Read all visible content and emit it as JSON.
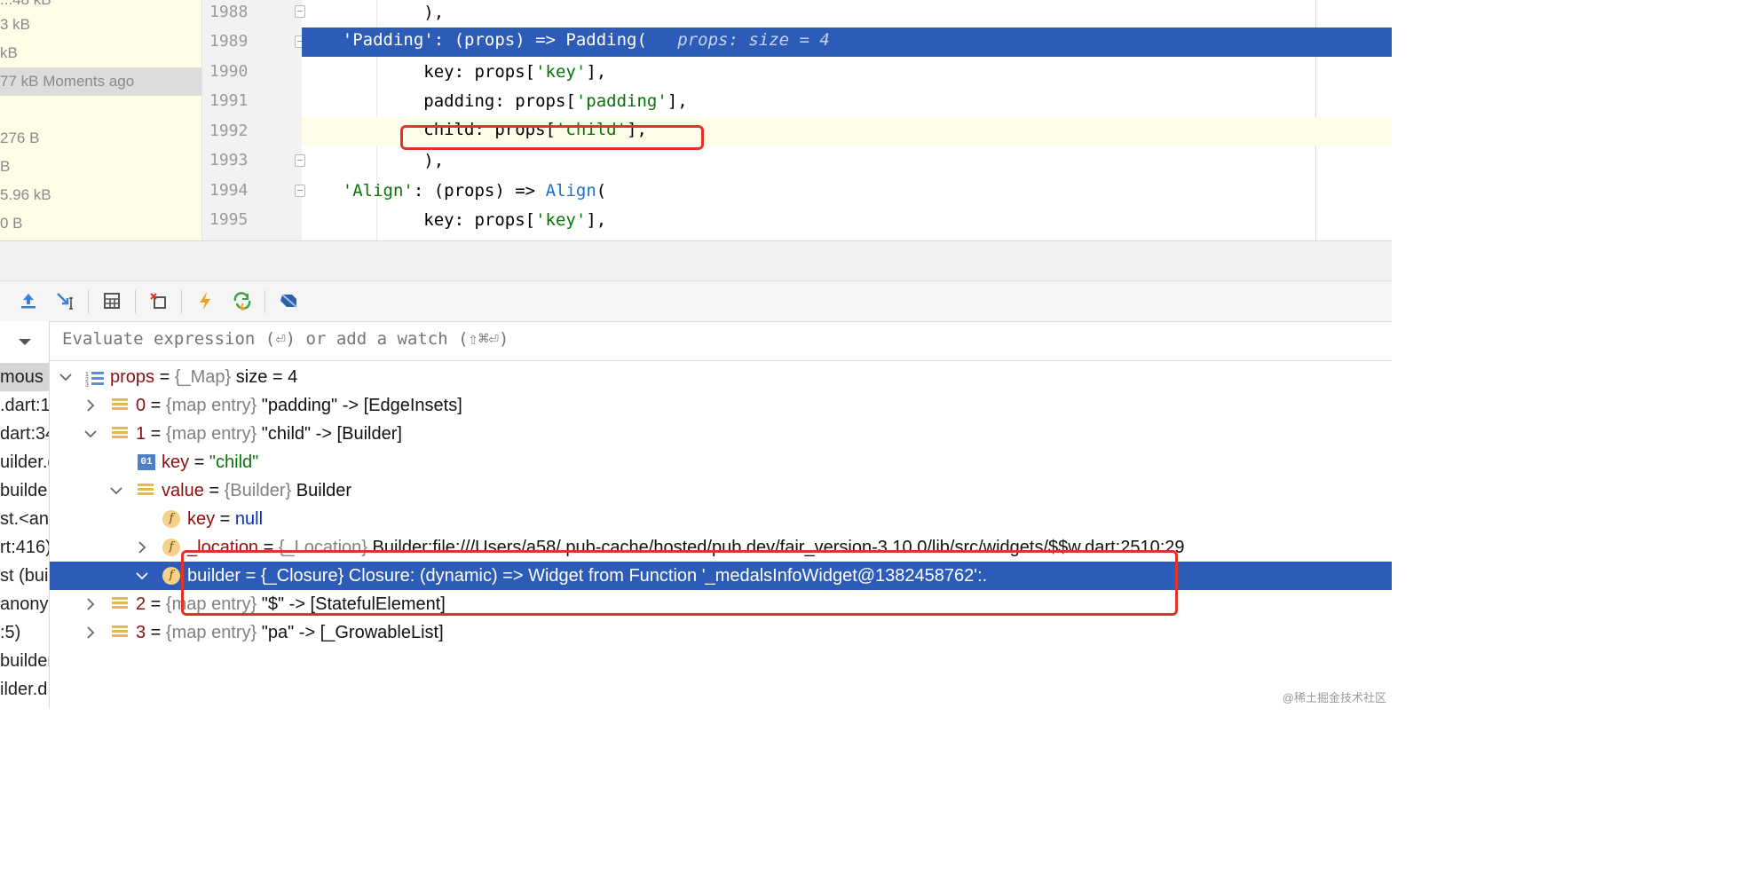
{
  "file_list": {
    "rows": [
      {
        "text": "...48 kB"
      },
      {
        "text": "3 kB"
      },
      {
        "text": "kB"
      },
      {
        "text": "77 kB Moments ago"
      },
      {
        "text": ""
      },
      {
        "text": "276 B"
      },
      {
        "text": "B"
      },
      {
        "text": "5.96 kB"
      },
      {
        "text": "0 B"
      }
    ]
  },
  "editor": {
    "lines": [
      {
        "num": "1988",
        "code": "            ),"
      },
      {
        "num": "1989",
        "code_a": "'Padding'",
        "code_b": ": (props) => Padding(",
        "hint": "props: size = 4"
      },
      {
        "num": "1990",
        "pre": "    key: props[",
        "str": "'key'",
        "post": "],"
      },
      {
        "num": "1991",
        "pre": "    padding: props[",
        "str": "'padding'",
        "post": "],"
      },
      {
        "num": "1992",
        "pre": "    child: props[",
        "str": "'child'",
        "post": "],"
      },
      {
        "num": "1993",
        "code": "            ),"
      },
      {
        "num": "1994",
        "str": "'Align'",
        "mid": ": (props) => ",
        "fn": "Align",
        "post": "("
      },
      {
        "num": "1995",
        "pre": "    key: props[",
        "str": "'key'",
        "post": "],"
      }
    ]
  },
  "toolbar": {
    "buttons": [
      {
        "name": "step-out-icon"
      },
      {
        "name": "run-to-cursor-icon"
      },
      {
        "name": "evaluate-icon"
      },
      {
        "name": "drop-frame-icon"
      },
      {
        "name": "hot-reload-icon"
      },
      {
        "name": "hot-restart-icon"
      },
      {
        "name": "dart-devtools-icon"
      }
    ]
  },
  "evaluate": {
    "placeholder": "Evaluate expression (⏎) or add a watch (⇧⌘⏎)"
  },
  "frames": [
    {
      "text": "mous"
    },
    {
      "text": ".dart:1"
    },
    {
      "text": "dart:34"
    },
    {
      "text": "uilder.d"
    },
    {
      "text": "builde"
    },
    {
      "text": "st.<an"
    },
    {
      "text": "rt:416)"
    },
    {
      "text": "st (bui"
    },
    {
      "text": "anony"
    },
    {
      "text": ":5)"
    },
    {
      "text": "builder"
    },
    {
      "text": "ilder.d"
    }
  ],
  "variables": {
    "props": {
      "name": "props",
      "eq": " = ",
      "type": "{_Map}",
      "val": " size = 4"
    },
    "entry0": {
      "name": "0",
      "eq": " = ",
      "type": "{map entry}",
      "val": " \"padding\" -> [EdgeInsets]"
    },
    "entry1": {
      "name": "1",
      "eq": " = ",
      "type": "{map entry}",
      "val": " \"child\" -> [Builder]"
    },
    "key": {
      "name": "key",
      "eq": " = ",
      "val": "\"child\""
    },
    "value": {
      "name": "value",
      "eq": " = ",
      "type": "{Builder}",
      "val": " Builder"
    },
    "value_key": {
      "name": "key",
      "eq": " = ",
      "val": "null"
    },
    "location": {
      "name": "_location",
      "eq": " = ",
      "type": "{_Location}",
      "val": " Builder:file:///Users/a58/.pub-cache/hosted/pub.dev/fair_version-3.10.0/lib/src/widgets/$$w.dart:2510:29"
    },
    "builder": {
      "name": "builder",
      "eq": " = ",
      "type": "{_Closure}",
      "val": " Closure: (dynamic) => Widget from Function '_medalsInfoWidget@1382458762':."
    },
    "entry2": {
      "name": "2",
      "eq": " = ",
      "type": "{map entry}",
      "val": " \"$\" -> [StatefulElement]"
    },
    "entry3": {
      "name": "3",
      "eq": " = ",
      "type": "{map entry}",
      "val": " \"pa\" -> [_GrowableList]"
    }
  },
  "watermark": "@稀土掘金技术社区",
  "colors": {
    "selection": "#2d5cb8",
    "annotation": "#e0342a",
    "string": "#087308"
  }
}
